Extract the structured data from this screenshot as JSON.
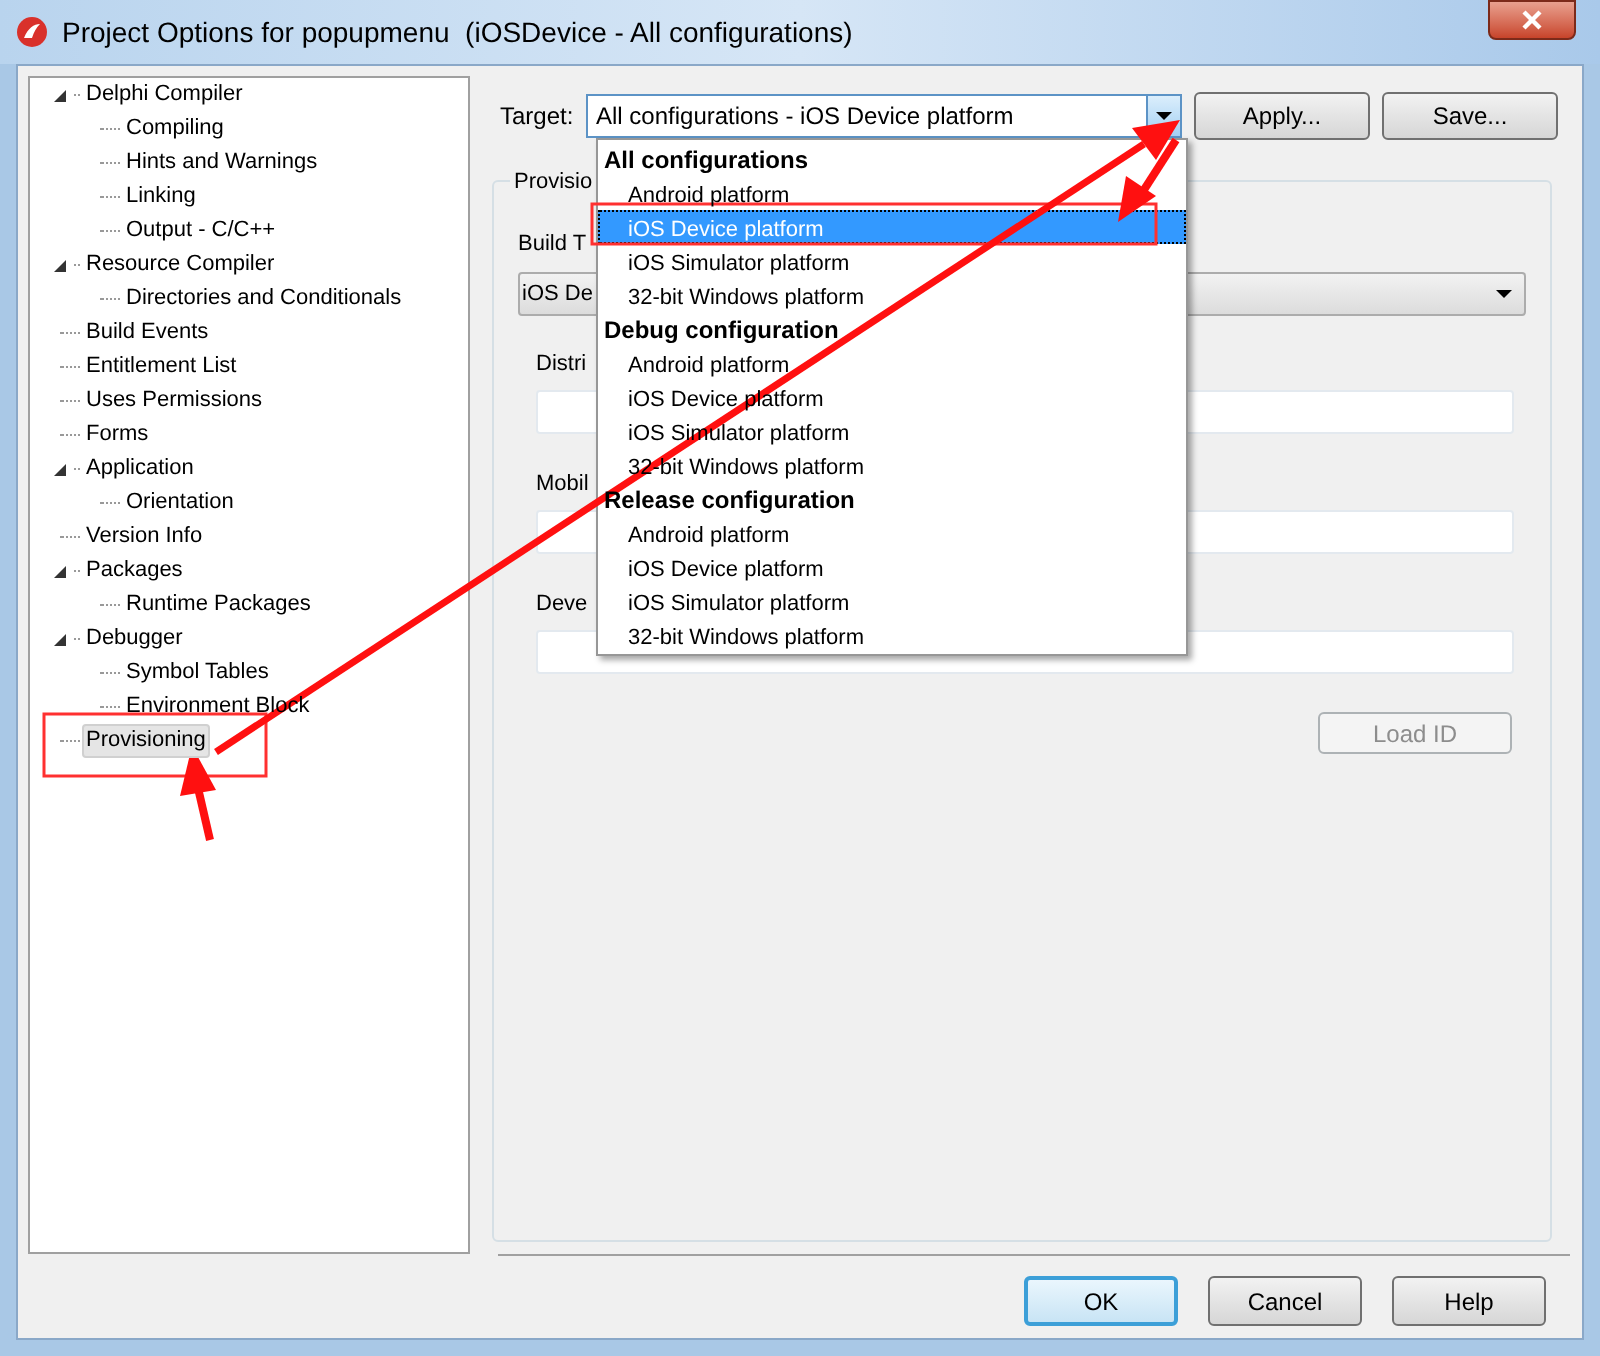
{
  "window": {
    "title": "Project Options for popupmenu  (iOSDevice - All configurations)"
  },
  "tree": [
    {
      "label": "Delphi Compiler",
      "expanded": true,
      "selected": false,
      "children": [
        {
          "label": "Compiling",
          "selected": false
        },
        {
          "label": "Hints and Warnings",
          "selected": false
        },
        {
          "label": "Linking",
          "selected": false
        },
        {
          "label": "Output - C/C++",
          "selected": false
        }
      ]
    },
    {
      "label": "Resource Compiler",
      "expanded": true,
      "selected": false,
      "children": [
        {
          "label": "Directories and Conditionals",
          "selected": false
        }
      ]
    },
    {
      "label": "Build Events",
      "selected": false
    },
    {
      "label": "Entitlement List",
      "selected": false
    },
    {
      "label": "Uses Permissions",
      "selected": false
    },
    {
      "label": "Forms",
      "selected": false
    },
    {
      "label": "Application",
      "expanded": true,
      "selected": false,
      "children": [
        {
          "label": "Orientation",
          "selected": false
        }
      ]
    },
    {
      "label": "Version Info",
      "selected": false
    },
    {
      "label": "Packages",
      "expanded": true,
      "selected": false,
      "children": [
        {
          "label": "Runtime Packages",
          "selected": false
        }
      ]
    },
    {
      "label": "Debugger",
      "expanded": true,
      "selected": false,
      "children": [
        {
          "label": "Symbol Tables",
          "selected": false
        },
        {
          "label": "Environment Block",
          "selected": false
        }
      ]
    },
    {
      "label": "Provisioning",
      "selected": true
    }
  ],
  "target": {
    "label": "Target:",
    "value": "All configurations - iOS Device platform",
    "expanded": true
  },
  "top_buttons": [
    "Apply...",
    "Save..."
  ],
  "dropdown": [
    {
      "heading": "All configurations",
      "items": [
        {
          "label": "Android platform",
          "selected": false
        },
        {
          "label": "iOS Device platform",
          "selected": true
        },
        {
          "label": "iOS Simulator platform",
          "selected": false
        },
        {
          "label": "32-bit Windows platform",
          "selected": false
        }
      ]
    },
    {
      "heading": "Debug configuration",
      "items": [
        {
          "label": "Android platform",
          "selected": false
        },
        {
          "label": "iOS Device platform",
          "selected": false
        },
        {
          "label": "iOS Simulator platform",
          "selected": false
        },
        {
          "label": "32-bit Windows platform",
          "selected": false
        }
      ]
    },
    {
      "heading": "Release configuration",
      "items": [
        {
          "label": "Android platform",
          "selected": false
        },
        {
          "label": "iOS Device platform",
          "selected": false
        },
        {
          "label": "iOS Simulator platform",
          "selected": false
        },
        {
          "label": "32-bit Windows platform",
          "selected": false
        }
      ]
    }
  ],
  "provisioning": {
    "caption": "Provisio",
    "build_type": {
      "label": "Build T",
      "value": "iOS De"
    },
    "fields": [
      {
        "label": "Distri"
      },
      {
        "label": "Mobil"
      },
      {
        "label": "Deve"
      }
    ],
    "load_id": {
      "label": "Load ID",
      "disabled": true
    }
  },
  "buttons": [
    {
      "label": "OK",
      "default": true
    },
    {
      "label": "Cancel",
      "default": false
    },
    {
      "label": "Help",
      "default": false
    }
  ]
}
